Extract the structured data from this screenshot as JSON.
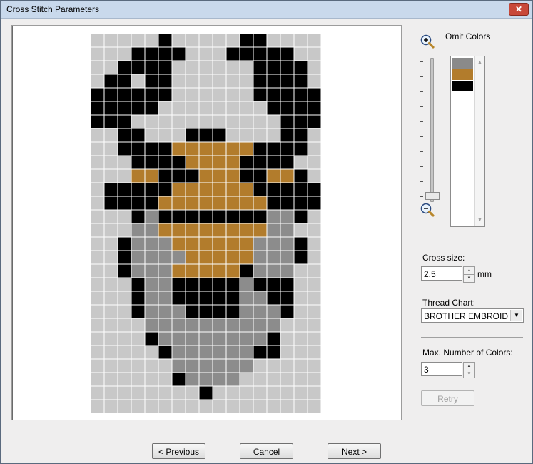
{
  "window": {
    "title": "Cross Stitch Parameters",
    "close_label": "✕"
  },
  "preview": {
    "fabric_color": "#c8c8c8",
    "grid_color": "#ffffff",
    "grid_cols": 17,
    "grid_rows": 28,
    "legend": {
      "K": "#000000",
      "B": "#b27c2c",
      "G": "#8c8c8c"
    },
    "pattern": [
      "00000K00000KK0000",
      "000KKKK000KKKKK00",
      "01KKKK000000KKKK0",
      "0KK0KK000000KKKK0",
      "KKKKKK000000KKKKK",
      "KKKKK00000000KKKK",
      "KKK00000000000KKK",
      "01KK000KKK0000KK0",
      "01KKKKBBBBBBKKKK0",
      "001KKKKBBBBKKKK00",
      "001BBKKKBBBKKBBK0",
      "0KKKKKBBBBBBKKKKK",
      "0KKKKBBBBBBBBKKKK",
      "001KGKKKKKKKKGGK0",
      "000GGBBBBBBBBGG00",
      "00KGGGBBBBBBGGGK0",
      "00KGGGGBBBBBGGGK0",
      "00KGGGBBBBBKGGG00",
      "000KGGKKKKKGKKK00",
      "000KGGKKKKKGGKK00",
      "000KGGGKKKKGGGK00",
      "0000GGGGGGGGGG000",
      "0000KGGGGGGGGK000",
      "00000KGGGGGGKK000",
      "000000GGGGGG00000",
      "000000KGGGG000000",
      "00000000K00000000",
      "00000000000000000"
    ]
  },
  "zoom": {
    "zoom_in_icon": "magnifier-plus-icon",
    "zoom_out_icon": "magnifier-minus-icon",
    "level": 0.0
  },
  "omit_colors": {
    "label": "Omit Colors",
    "swatches": [
      "#8a8a8a",
      "#b27c2c",
      "#000000"
    ]
  },
  "cross_size": {
    "label": "Cross size:",
    "value": "2.5",
    "unit": "mm"
  },
  "thread_chart": {
    "label": "Thread Chart:",
    "selected": "BROTHER EMBROIDERY"
  },
  "max_colors": {
    "label": "Max. Number of Colors:",
    "value": "3"
  },
  "buttons": {
    "retry": "Retry",
    "previous": "< Previous",
    "cancel": "Cancel",
    "next": "Next >"
  }
}
